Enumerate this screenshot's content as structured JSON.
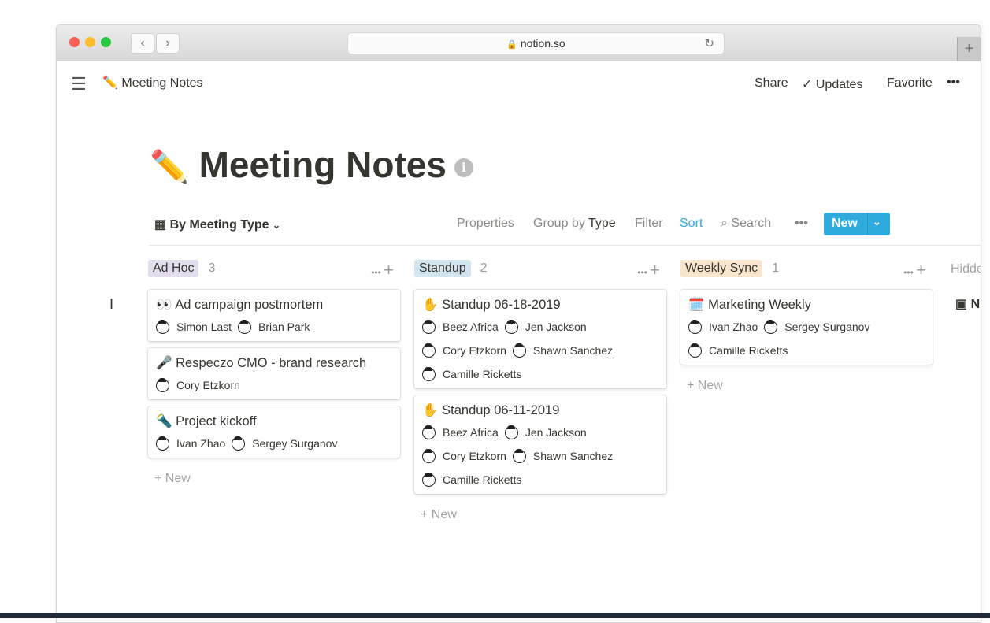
{
  "browser": {
    "url": "notion.so",
    "colors": {
      "close": "#fc5f57",
      "minimize": "#fdbc2e",
      "zoom": "#28c840"
    }
  },
  "topbar": {
    "page_icon": "✏️",
    "breadcrumb": "Meeting Notes",
    "share": "Share",
    "updates": "Updates",
    "favorite": "Favorite",
    "more": "•••"
  },
  "page": {
    "icon": "✏️",
    "title": "Meeting Notes"
  },
  "toolbar": {
    "view": "By Meeting Type",
    "properties": "Properties",
    "group_by": "Group by",
    "group_by_value": "Type",
    "filter": "Filter",
    "sort": "Sort",
    "search": "Search",
    "more": "•••",
    "new": "New"
  },
  "accent": "#2eaadc",
  "columns": [
    {
      "label": "Ad Hoc",
      "count": "3",
      "color": "#e3deed",
      "cards": [
        {
          "icon": "👀",
          "title": "Ad campaign postmortem",
          "people": [
            "Simon Last",
            "Brian Park"
          ]
        },
        {
          "icon": "🎤",
          "title": "Respeczo CMO - brand research",
          "people": [
            "Cory Etzkorn"
          ]
        },
        {
          "icon": "🔦",
          "title": "Project kickoff",
          "people": [
            "Ivan Zhao",
            "Sergey Surganov"
          ]
        }
      ],
      "new": "New"
    },
    {
      "label": "Standup",
      "count": "2",
      "color": "#d3e5ef",
      "cards": [
        {
          "icon": "✋",
          "title": "Standup 06-18-2019",
          "people": [
            "Beez Africa",
            "Jen Jackson",
            "Cory Etzkorn",
            "Shawn Sanchez",
            "Camille Ricketts"
          ]
        },
        {
          "icon": "✋",
          "title": "Standup 06-11-2019",
          "people": [
            "Beez Africa",
            "Jen Jackson",
            "Cory Etzkorn",
            "Shawn Sanchez",
            "Camille Ricketts"
          ]
        }
      ],
      "new": "New"
    },
    {
      "label": "Weekly Sync",
      "count": "1",
      "color": "#fae6cf",
      "cards": [
        {
          "icon": "🗓️",
          "title": "Marketing Weekly",
          "people": [
            "Ivan Zhao",
            "Sergey Surganov",
            "Camille Ricketts"
          ]
        }
      ],
      "new": "New"
    }
  ],
  "hidden": {
    "label": "Hidden",
    "item": "N"
  }
}
